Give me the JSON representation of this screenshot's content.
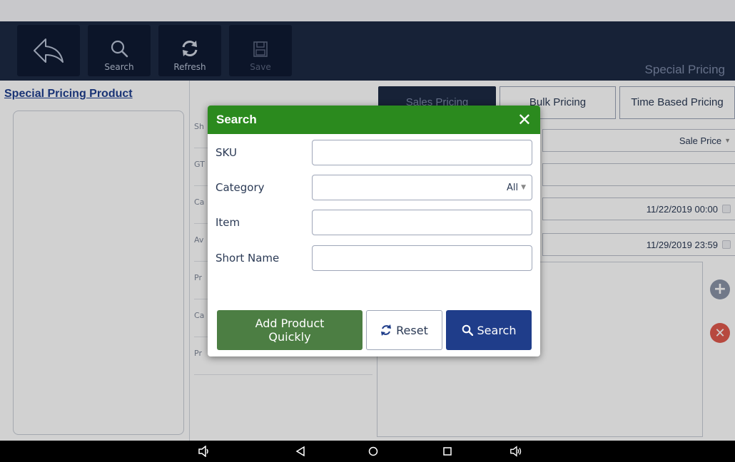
{
  "toolbar": {
    "search_label": "Search",
    "refresh_label": "Refresh",
    "save_label": "Save",
    "screen_title": "Special Pricing"
  },
  "left_panel": {
    "title": "Special Pricing Product"
  },
  "form_rows": [
    "Sh",
    "GT",
    "Ca",
    "Av",
    "Pr",
    "Ca",
    "Pr"
  ],
  "tabs": [
    {
      "label": "Sales Pricing",
      "active": true
    },
    {
      "label": "Bulk Pricing",
      "active": false
    },
    {
      "label": "Time Based Pricing",
      "active": false
    }
  ],
  "right_fields": {
    "price_type": "Sale Price",
    "start_datetime": "11/22/2019 00:00",
    "end_datetime": "11/29/2019 23:59"
  },
  "dialog": {
    "title": "Search",
    "fields": {
      "sku_label": "SKU",
      "sku_value": "",
      "category_label": "Category",
      "category_value": "All",
      "item_label": "Item",
      "item_value": "",
      "short_name_label": "Short Name",
      "short_name_value": ""
    },
    "buttons": {
      "add_quick": "Add Product Quickly",
      "reset": "Reset",
      "search": "Search"
    }
  },
  "colors": {
    "toolbar_bg": "#1d2a44",
    "dialog_header": "#2b8a1e",
    "add_button": "#4c7e43",
    "search_button": "#1f3d8a",
    "link_blue": "#1f3f8f"
  }
}
